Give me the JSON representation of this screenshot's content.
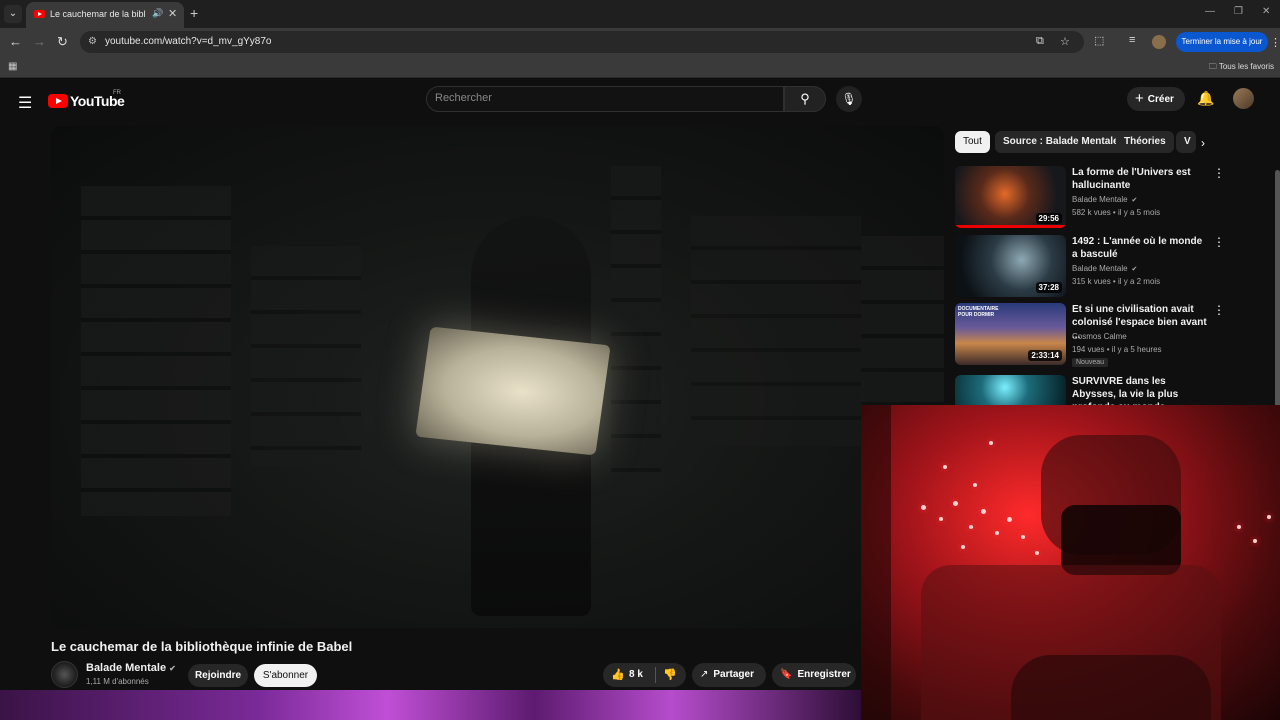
{
  "browser": {
    "tab": {
      "title": "Le cauchemar de la biblioth",
      "audio_icon": "speaker-icon",
      "close_icon": "close-icon"
    },
    "new_tab_icon": "plus-icon",
    "address": {
      "url": "youtube.com/watch?v=d_mv_gYy87o"
    },
    "update_button": "Terminer la mise à jour",
    "bookmarks_label": "Tous les favoris"
  },
  "youtube": {
    "logo_text": "YouTube",
    "country": "FR",
    "search_placeholder": "Rechercher",
    "create_label": "Créer"
  },
  "video": {
    "title": "Le cauchemar de la bibliothèque infinie de Babel",
    "channel": "Balade Mentale",
    "subscribers": "1,11 M d'abonnés",
    "join_label": "Rejoindre",
    "subscribe_label": "S'abonner",
    "likes": "8 k",
    "share_label": "Partager",
    "save_label": "Enregistrer"
  },
  "chips": [
    "Tout",
    "Source : Balade Mentale",
    "Théories",
    "V"
  ],
  "recommendations": [
    {
      "title": "La forme de l'Univers est hallucinante",
      "channel": "Balade Mentale",
      "verified": true,
      "meta": "582 k vues • il y a 5 mois",
      "duration": "29:56",
      "thumb_color": "#4a2418"
    },
    {
      "title": "1492 : L'année où le monde a basculé",
      "channel": "Balade Mentale",
      "verified": true,
      "meta": "315 k vues • il y a 2 mois",
      "duration": "37:28",
      "thumb_color": "#1d2a33"
    },
    {
      "title": "Et si une civilisation avait colonisé l'espace bien avant ...",
      "channel": "Cosmos Calme",
      "verified": false,
      "meta": "194 vues • il y a 5 heures",
      "duration": "2:33:14",
      "badge": "Nouveau",
      "thumb_label": "DOCUMENTAIRE POUR DORMIR",
      "thumb_color": "#3c4a7a"
    },
    {
      "title": "SURVIVRE dans les Abysses, la vie la plus profonde au monde",
      "thumb_color": "#0e3a44"
    }
  ]
}
